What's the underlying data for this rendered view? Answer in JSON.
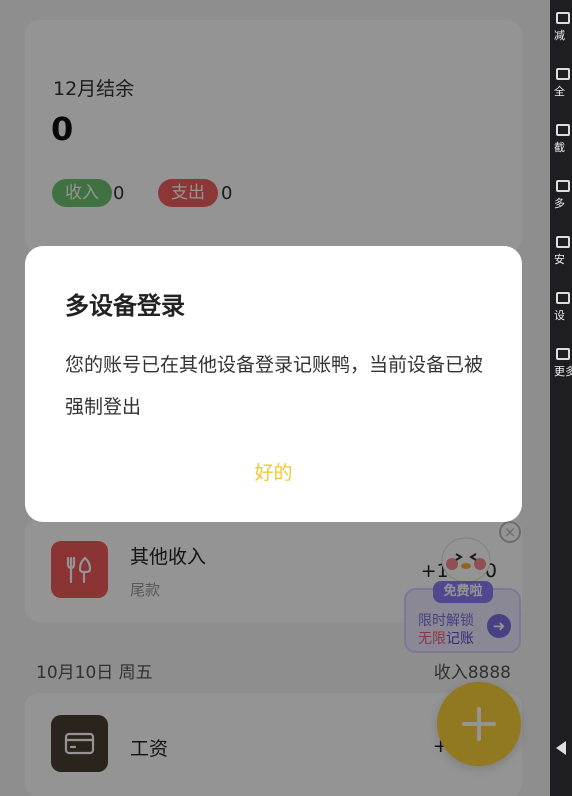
{
  "summary": {
    "month_label": "12月结余",
    "balance": "0",
    "income_label": "收入",
    "income_count": "0",
    "expense_label": "支出",
    "expense_count": "0"
  },
  "transactions": {
    "row1": {
      "title": "其他收入",
      "subtitle": "尾款",
      "amount": "+10000"
    },
    "day_header": {
      "date": "10月10日 周五",
      "income": "收入8888"
    },
    "row2": {
      "title": "工资",
      "amount": "+8888"
    }
  },
  "promo": {
    "badge": "免费啦",
    "line1": "限时解锁",
    "line2_highlight": "无限",
    "line2_rest": "记账"
  },
  "dialog": {
    "title": "多设备登录",
    "message": "您的账号已在其他设备登录记账鸭，当前设备已被强制登出",
    "ok_label": "好的"
  },
  "side_toolbar": {
    "items": [
      "减",
      "全",
      "截",
      "多",
      "安",
      "设",
      "更多"
    ]
  },
  "colors": {
    "accent": "#f5c531",
    "income_green": "#6fc36f",
    "expense_red": "#ef5f5f",
    "promo_purple": "#7b6fe0"
  }
}
